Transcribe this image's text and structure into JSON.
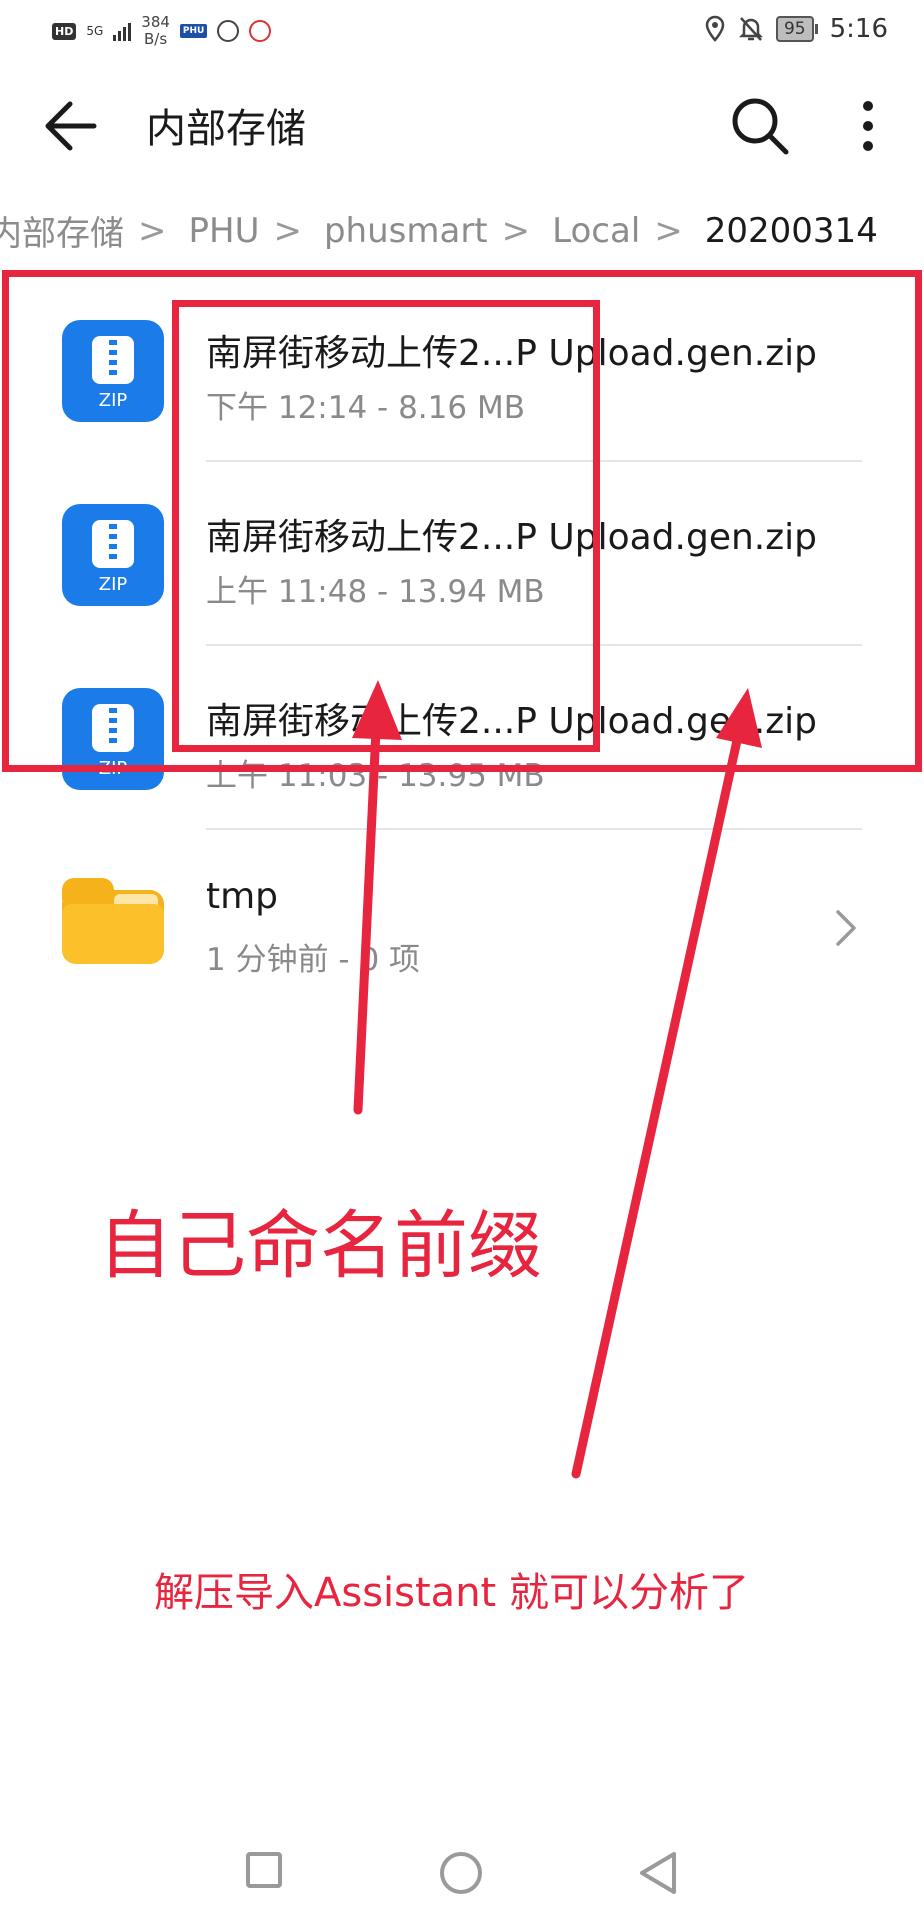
{
  "status_bar": {
    "hd": "HD",
    "network": "5G",
    "speed_value": "384",
    "speed_unit": "B/s",
    "app_badge": "PHU",
    "battery": "95",
    "time": "5:16"
  },
  "app_bar": {
    "title": "内部存储"
  },
  "breadcrumb": [
    "内部存储",
    "PHU",
    "phusmart",
    "Local",
    "20200314"
  ],
  "files": [
    {
      "name": "南屏街移动上传2...P Upload.gen.zip",
      "meta": "下午 12:14  - 8.16 MB",
      "type": "zip",
      "icon_label": "ZIP"
    },
    {
      "name": "南屏街移动上传2...P Upload.gen.zip",
      "meta": "上午 11:48  - 13.94 MB",
      "type": "zip",
      "icon_label": "ZIP"
    },
    {
      "name": "南屏街移动上传2...P Upload.gen.zip",
      "meta": "上午 11:03  - 13.95 MB",
      "type": "zip",
      "icon_label": "ZIP"
    }
  ],
  "folder": {
    "name": "tmp",
    "meta": "1 分钟前 - 0 项"
  },
  "annotations": {
    "prefix_note": "自己命名前缀",
    "analyze_note": "解压导入Assistant 就可以分析了",
    "color": "#e8253f"
  },
  "colors": {
    "zip_icon": "#1a7be9",
    "folder_icon": "#fcc12a"
  }
}
